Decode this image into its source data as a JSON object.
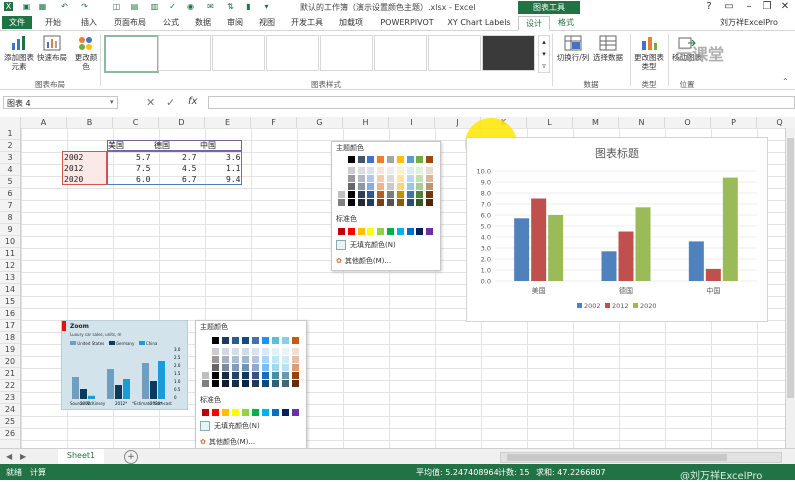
{
  "window": {
    "title": "默认的工作簿（演示设置颜色主题）.xlsx - Excel",
    "context_tab_group": "图表工具",
    "account": "刘万祥ExcelPro"
  },
  "tabs": [
    "文件",
    "开始",
    "插入",
    "页面布局",
    "公式",
    "数据",
    "审阅",
    "视图",
    "开发工具",
    "加载项",
    "POWERPIVOT",
    "XY Chart Labels",
    "设计",
    "格式"
  ],
  "active_tab": "设计",
  "ribbon": {
    "add_element": "添加图表元素",
    "quick_layout": "快速布局",
    "change_colors": "更改颜色",
    "group_layout": "图表布局",
    "group_styles": "图表样式",
    "switch_row_col": "切换行/列",
    "select_data": "选择数据",
    "group_data": "数据",
    "change_type": "更改图表类型",
    "group_type": "类型",
    "move_chart": "移动图表",
    "group_location": "位置",
    "watermark": "云课堂"
  },
  "formula_bar": {
    "name_box": "图表 4",
    "fx": "fx",
    "content": ""
  },
  "columns": [
    "A",
    "B",
    "C",
    "D",
    "E",
    "F",
    "G",
    "H",
    "I",
    "J",
    "K",
    "L",
    "M",
    "N",
    "O",
    "P",
    "Q"
  ],
  "rows": [
    "1",
    "2",
    "3",
    "4",
    "5",
    "6",
    "7",
    "8",
    "9",
    "10",
    "11",
    "12",
    "13",
    "14",
    "15",
    "16",
    "17",
    "18",
    "19",
    "20",
    "21",
    "22",
    "23",
    "24",
    "25",
    "26"
  ],
  "table": {
    "headers": [
      "美国",
      "德国",
      "中国"
    ],
    "rows": [
      {
        "year": "2002",
        "values": [
          "5.7",
          "2.7",
          "3.6"
        ]
      },
      {
        "year": "2012",
        "values": [
          "7.5",
          "4.5",
          "1.1"
        ]
      },
      {
        "year": "2020",
        "values": [
          "6.0",
          "6.7",
          "9.4"
        ]
      }
    ]
  },
  "palette_top": {
    "theme_colors_label": "主题颜色",
    "standard_colors_label": "标准色",
    "no_fill": "无填充颜色(N)",
    "more_colors": "其他颜色(M)...",
    "theme_row": [
      "#ffffff",
      "#000000",
      "#44546a",
      "#4472c4",
      "#ed7d31",
      "#a5a5a5",
      "#ffc000",
      "#5b9bd5",
      "#70ad47",
      "#9e480e"
    ],
    "standard_row": [
      "#c00000",
      "#ff0000",
      "#ffc000",
      "#ffff00",
      "#92d050",
      "#00b050",
      "#00b0f0",
      "#0070c0",
      "#002060",
      "#7030a0"
    ]
  },
  "palette_bottom": {
    "theme_colors_label": "主题颜色",
    "standard_colors_label": "标准色",
    "no_fill": "无填充颜色(N)",
    "more_colors": "其他颜色(M)...",
    "theme_row": [
      "#ffffff",
      "#000000",
      "#1f3864",
      "#2e5c8a",
      "#0f4c81",
      "#4a6fa5",
      "#1e90ff",
      "#5bc0de",
      "#87ceeb",
      "#c55a11"
    ],
    "standard_row": [
      "#c00000",
      "#ff0000",
      "#ffc000",
      "#ffff00",
      "#92d050",
      "#00b050",
      "#00b0f0",
      "#0070c0",
      "#002060",
      "#7030a0"
    ]
  },
  "reference_image": {
    "title": "Zoom",
    "subtitle": "Luxury car sales, units, m",
    "legend": [
      "United States",
      "Germany",
      "China"
    ],
    "categories": [
      "2002",
      "2012*",
      "2020*"
    ],
    "footer_left": "Source: McKinsey",
    "footer_right": "*Estimate  *Forecast",
    "yticks": [
      "3.0",
      "2.5",
      "2.0",
      "1.5",
      "1.0",
      "0.5",
      "0"
    ]
  },
  "chart_data": {
    "type": "bar",
    "title": "图表标题",
    "categories": [
      "美国",
      "德国",
      "中国"
    ],
    "series": [
      {
        "name": "2002",
        "values": [
          5.7,
          2.7,
          3.6
        ],
        "color": "#4f81bd"
      },
      {
        "name": "2012",
        "values": [
          7.5,
          4.5,
          1.1
        ],
        "color": "#c0504d"
      },
      {
        "name": "2020",
        "values": [
          6.0,
          6.7,
          9.4
        ],
        "color": "#9bbb59"
      }
    ],
    "ylim": [
      0,
      10
    ],
    "yticks": [
      "10.0",
      "9.0",
      "8.0",
      "7.0",
      "6.0",
      "5.0",
      "4.0",
      "3.0",
      "2.0",
      "1.0",
      "0.0"
    ],
    "legend_position": "bottom",
    "grid": true
  },
  "sheet_tabs": {
    "active": "Sheet1",
    "add": "+"
  },
  "status": {
    "mode": "就绪",
    "calc": "计算",
    "average": "平均值: 5.247408964",
    "count": "计数: 15",
    "sum": "求和: 47.2266807",
    "zoom_watermark": "@刘万祥ExcelPro"
  }
}
